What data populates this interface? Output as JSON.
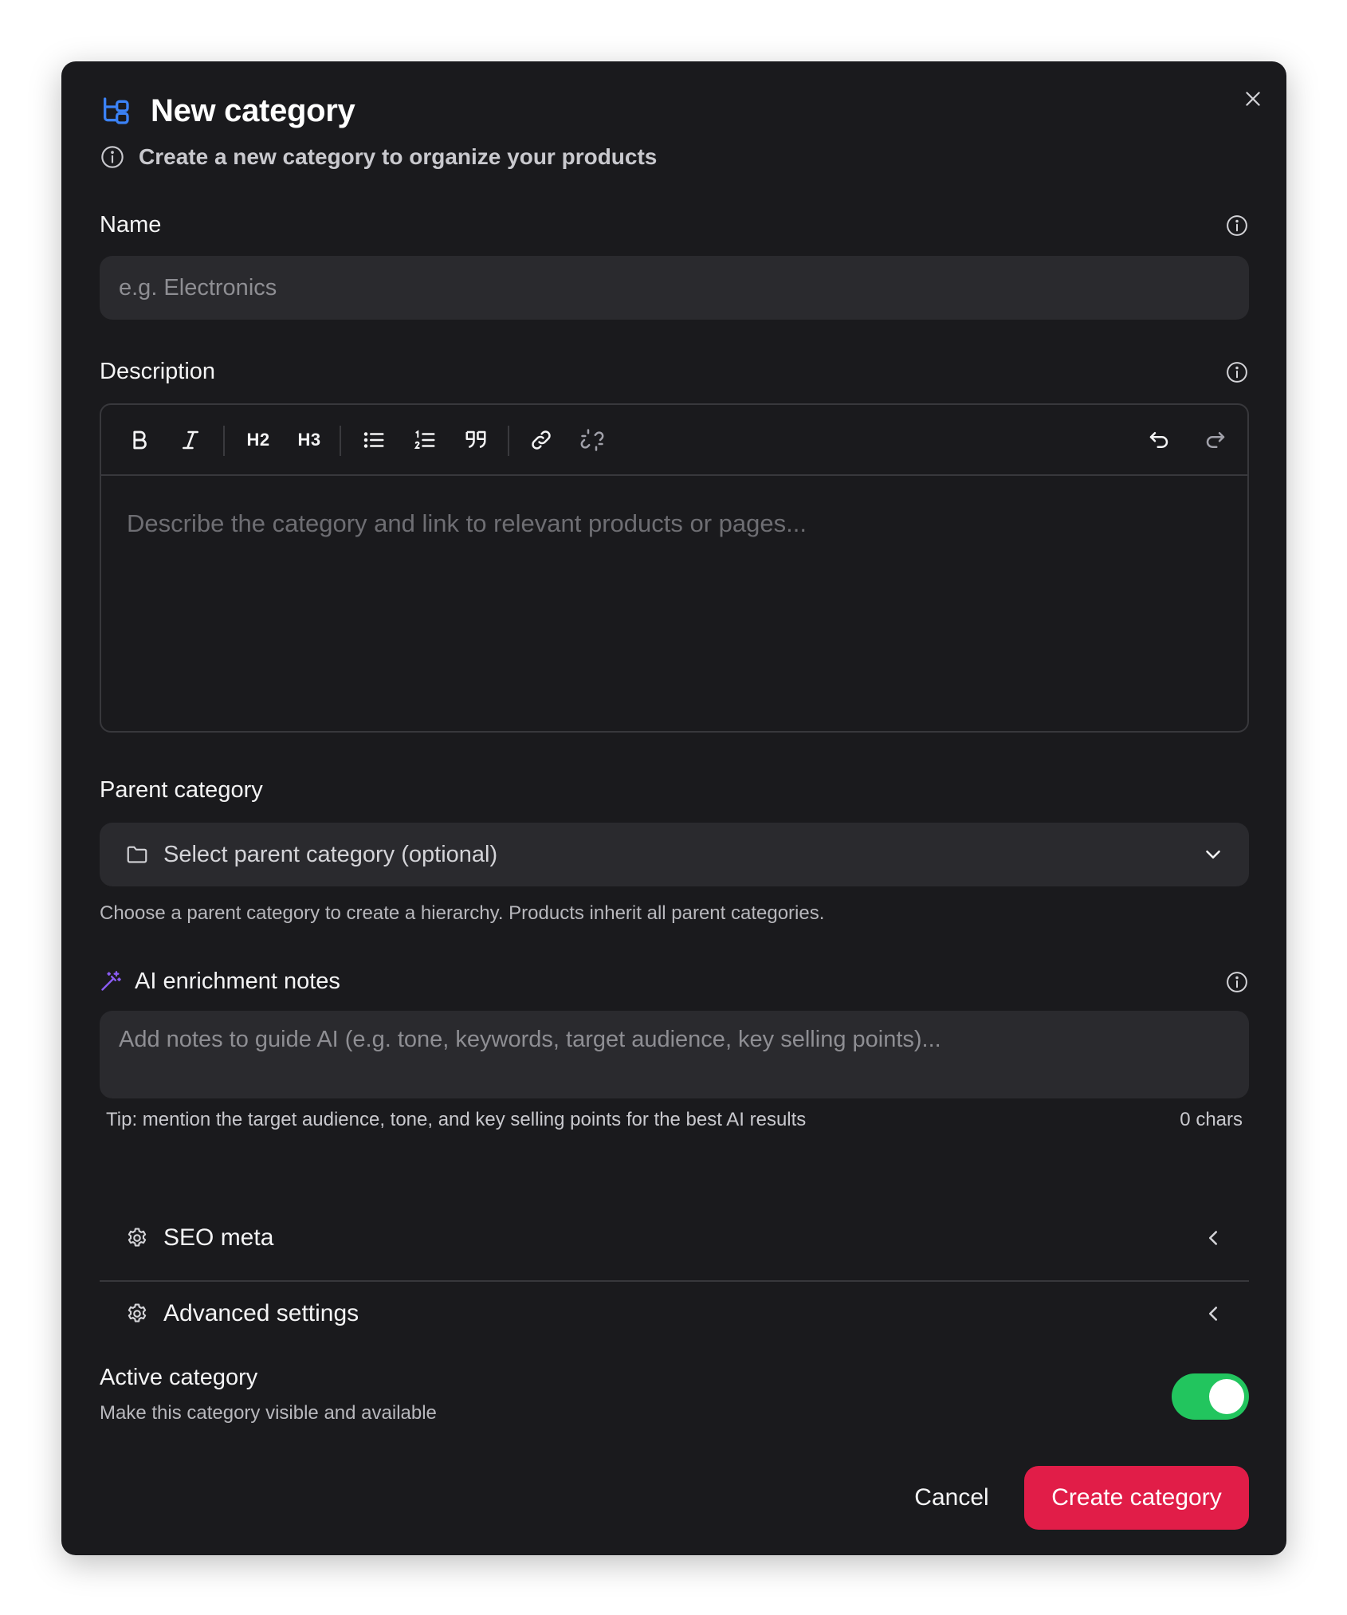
{
  "dialog": {
    "title": "New category",
    "subtitle": "Create a new category to organize your products"
  },
  "name_field": {
    "label": "Name",
    "placeholder": "e.g. Electronics",
    "value": ""
  },
  "description_field": {
    "label": "Description",
    "placeholder": "Describe the category and link to relevant products or pages...",
    "toolbar": {
      "h2_label": "H2",
      "h3_label": "H3",
      "buttons": [
        "bold",
        "italic",
        "heading-2",
        "heading-3",
        "bullet-list",
        "ordered-list",
        "blockquote",
        "link",
        "unlink",
        "undo",
        "redo"
      ]
    }
  },
  "parent_field": {
    "label": "Parent category",
    "placeholder": "Select parent category (optional)",
    "help": "Choose a parent category to create a hierarchy. Products inherit all parent categories."
  },
  "ai_notes": {
    "label": "AI enrichment notes",
    "placeholder": "Add notes to guide AI (e.g. tone, keywords, target audience, key selling points)...",
    "tip": "Tip: mention the target audience, tone, and key selling points for the best AI results",
    "char_count": "0 chars"
  },
  "sections": {
    "seo": "SEO meta",
    "advanced": "Advanced settings"
  },
  "active": {
    "label": "Active category",
    "description": "Make this category visible and available",
    "enabled": true
  },
  "footer": {
    "cancel": "Cancel",
    "create": "Create category"
  },
  "colors": {
    "background": "#1a1a1d",
    "input": "#2a2a2e",
    "accent_blue": "#3b82f6",
    "accent_purple": "#8b5cf6",
    "toggle_on": "#22c55e",
    "primary_button": "#e11d48"
  }
}
